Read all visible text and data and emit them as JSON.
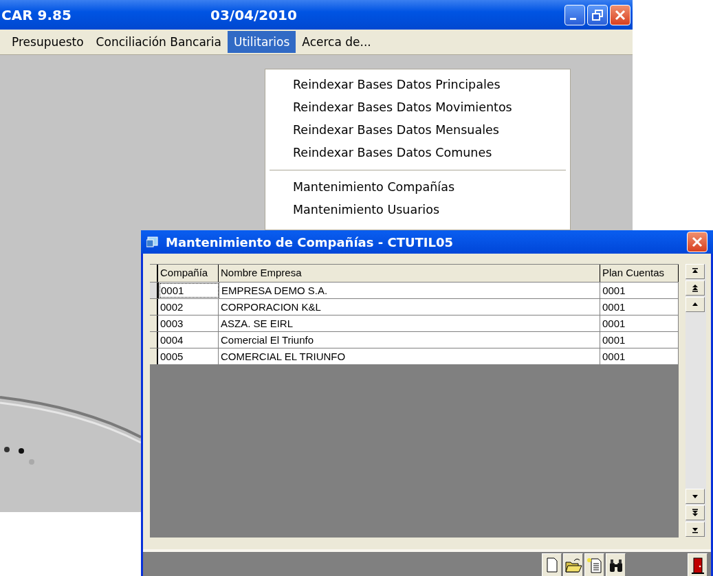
{
  "window": {
    "title": "CAR 9.85",
    "date": "03/04/2010"
  },
  "menu": [
    {
      "label": "Presupuesto",
      "selected": false
    },
    {
      "label": "Conciliación Bancaria",
      "selected": false
    },
    {
      "label": "Utilitarios",
      "selected": true
    },
    {
      "label": "Acerca de...",
      "selected": false
    }
  ],
  "dropdown": [
    {
      "kind": "item",
      "label": "Reindexar Bases Datos Principales"
    },
    {
      "kind": "item",
      "label": "Reindexar Bases Datos Movimientos"
    },
    {
      "kind": "item",
      "label": "Reindexar Bases Datos Mensuales"
    },
    {
      "kind": "item",
      "label": "Reindexar Bases Datos Comunes"
    },
    {
      "kind": "separator"
    },
    {
      "kind": "item",
      "label": "Mantenimiento Compañías"
    },
    {
      "kind": "item",
      "label": "Mantenimiento Usuarios"
    }
  ],
  "dialog": {
    "title": "Mantenimiento de Compañías - CTUTIL05",
    "table": {
      "columns": [
        "Compañía",
        "Nombre Empresa",
        "Plan Cuentas"
      ],
      "rows": [
        {
          "cells": [
            "0001",
            "EMPRESA DEMO S.A.",
            "0001"
          ],
          "selected": true
        },
        {
          "cells": [
            "0002",
            "CORPORACION K&L",
            "0001"
          ],
          "selected": false
        },
        {
          "cells": [
            "0003",
            "ASZA. SE EIRL",
            "0001"
          ],
          "selected": false
        },
        {
          "cells": [
            "0004",
            "Comercial El Triunfo",
            "0001"
          ],
          "selected": false
        },
        {
          "cells": [
            "0005",
            "COMERCIAL EL TRIUNFO",
            "0001"
          ],
          "selected": false
        }
      ]
    }
  }
}
